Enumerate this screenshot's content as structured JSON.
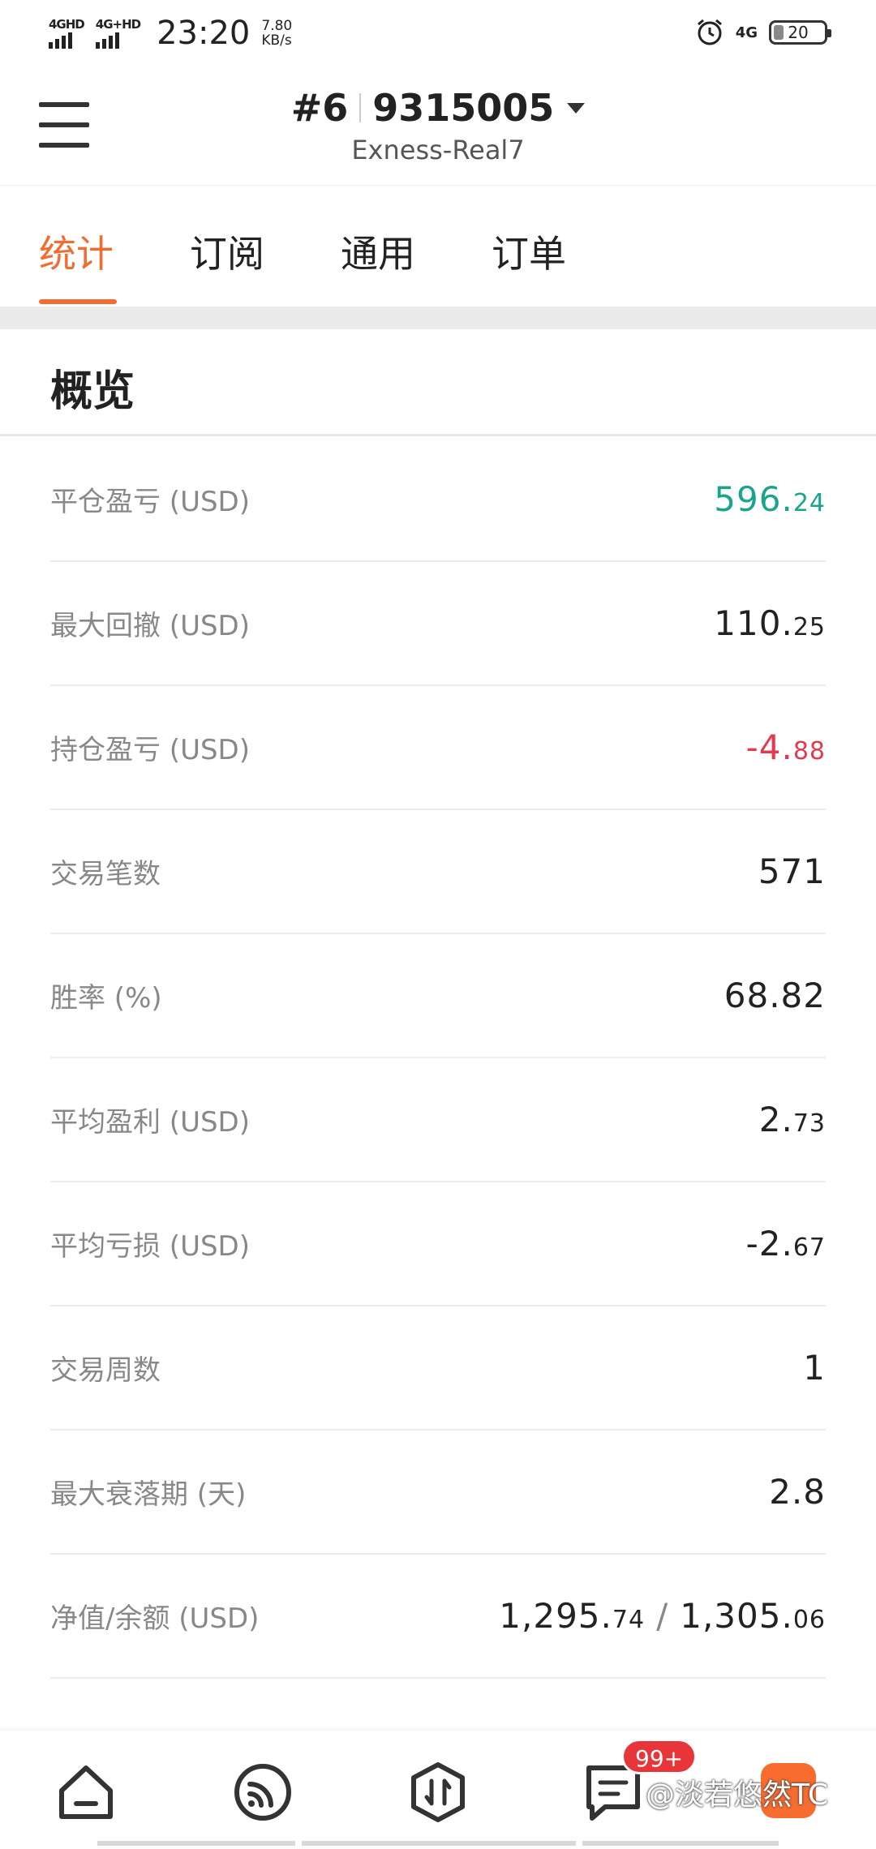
{
  "status_bar": {
    "sim1_label": "4GHD",
    "sim2_label": "4G+HD",
    "time": "23:20",
    "speed_value": "7.80",
    "speed_unit": "KB/s",
    "network": "4G",
    "battery": "20"
  },
  "header": {
    "account_prefix": "#6",
    "account_number": "9315005",
    "server": "Exness-Real7"
  },
  "tabs": [
    {
      "label": "统计",
      "active": true
    },
    {
      "label": "订阅",
      "active": false
    },
    {
      "label": "通用",
      "active": false
    },
    {
      "label": "订单",
      "active": false
    }
  ],
  "section_title": "概览",
  "stats": [
    {
      "label": "平仓盈亏 (USD)",
      "int": "596.",
      "dec": "24",
      "tone": "pos"
    },
    {
      "label": "最大回撤 (USD)",
      "int": "110.",
      "dec": "25",
      "tone": ""
    },
    {
      "label": "持仓盈亏 (USD)",
      "int": "-4.",
      "dec": "88",
      "tone": "neg"
    },
    {
      "label": "交易笔数",
      "int": "571",
      "dec": "",
      "tone": ""
    },
    {
      "label": "胜率 (%)",
      "int": "68.82",
      "dec": "",
      "tone": ""
    },
    {
      "label": "平均盈利 (USD)",
      "int": "2.",
      "dec": "73",
      "tone": ""
    },
    {
      "label": "平均亏损 (USD)",
      "int": "-2.",
      "dec": "67",
      "tone": ""
    },
    {
      "label": "交易周数",
      "int": "1",
      "dec": "",
      "tone": ""
    },
    {
      "label": "最大衰落期 (天)",
      "int": "2.8",
      "dec": "",
      "tone": ""
    },
    {
      "label": "净值/余额 (USD)",
      "int": "1,295.",
      "dec": "74",
      "int2": "1,305.",
      "dec2": "06",
      "tone": ""
    }
  ],
  "bottom_nav": {
    "items": [
      "home-icon",
      "feed-icon",
      "trade-icon",
      "messages-icon"
    ],
    "badge": "99+"
  },
  "watermark": "@淡若悠然TC",
  "colors": {
    "accent": "#f26c32",
    "positive": "#18a58c",
    "negative": "#e23b50"
  }
}
